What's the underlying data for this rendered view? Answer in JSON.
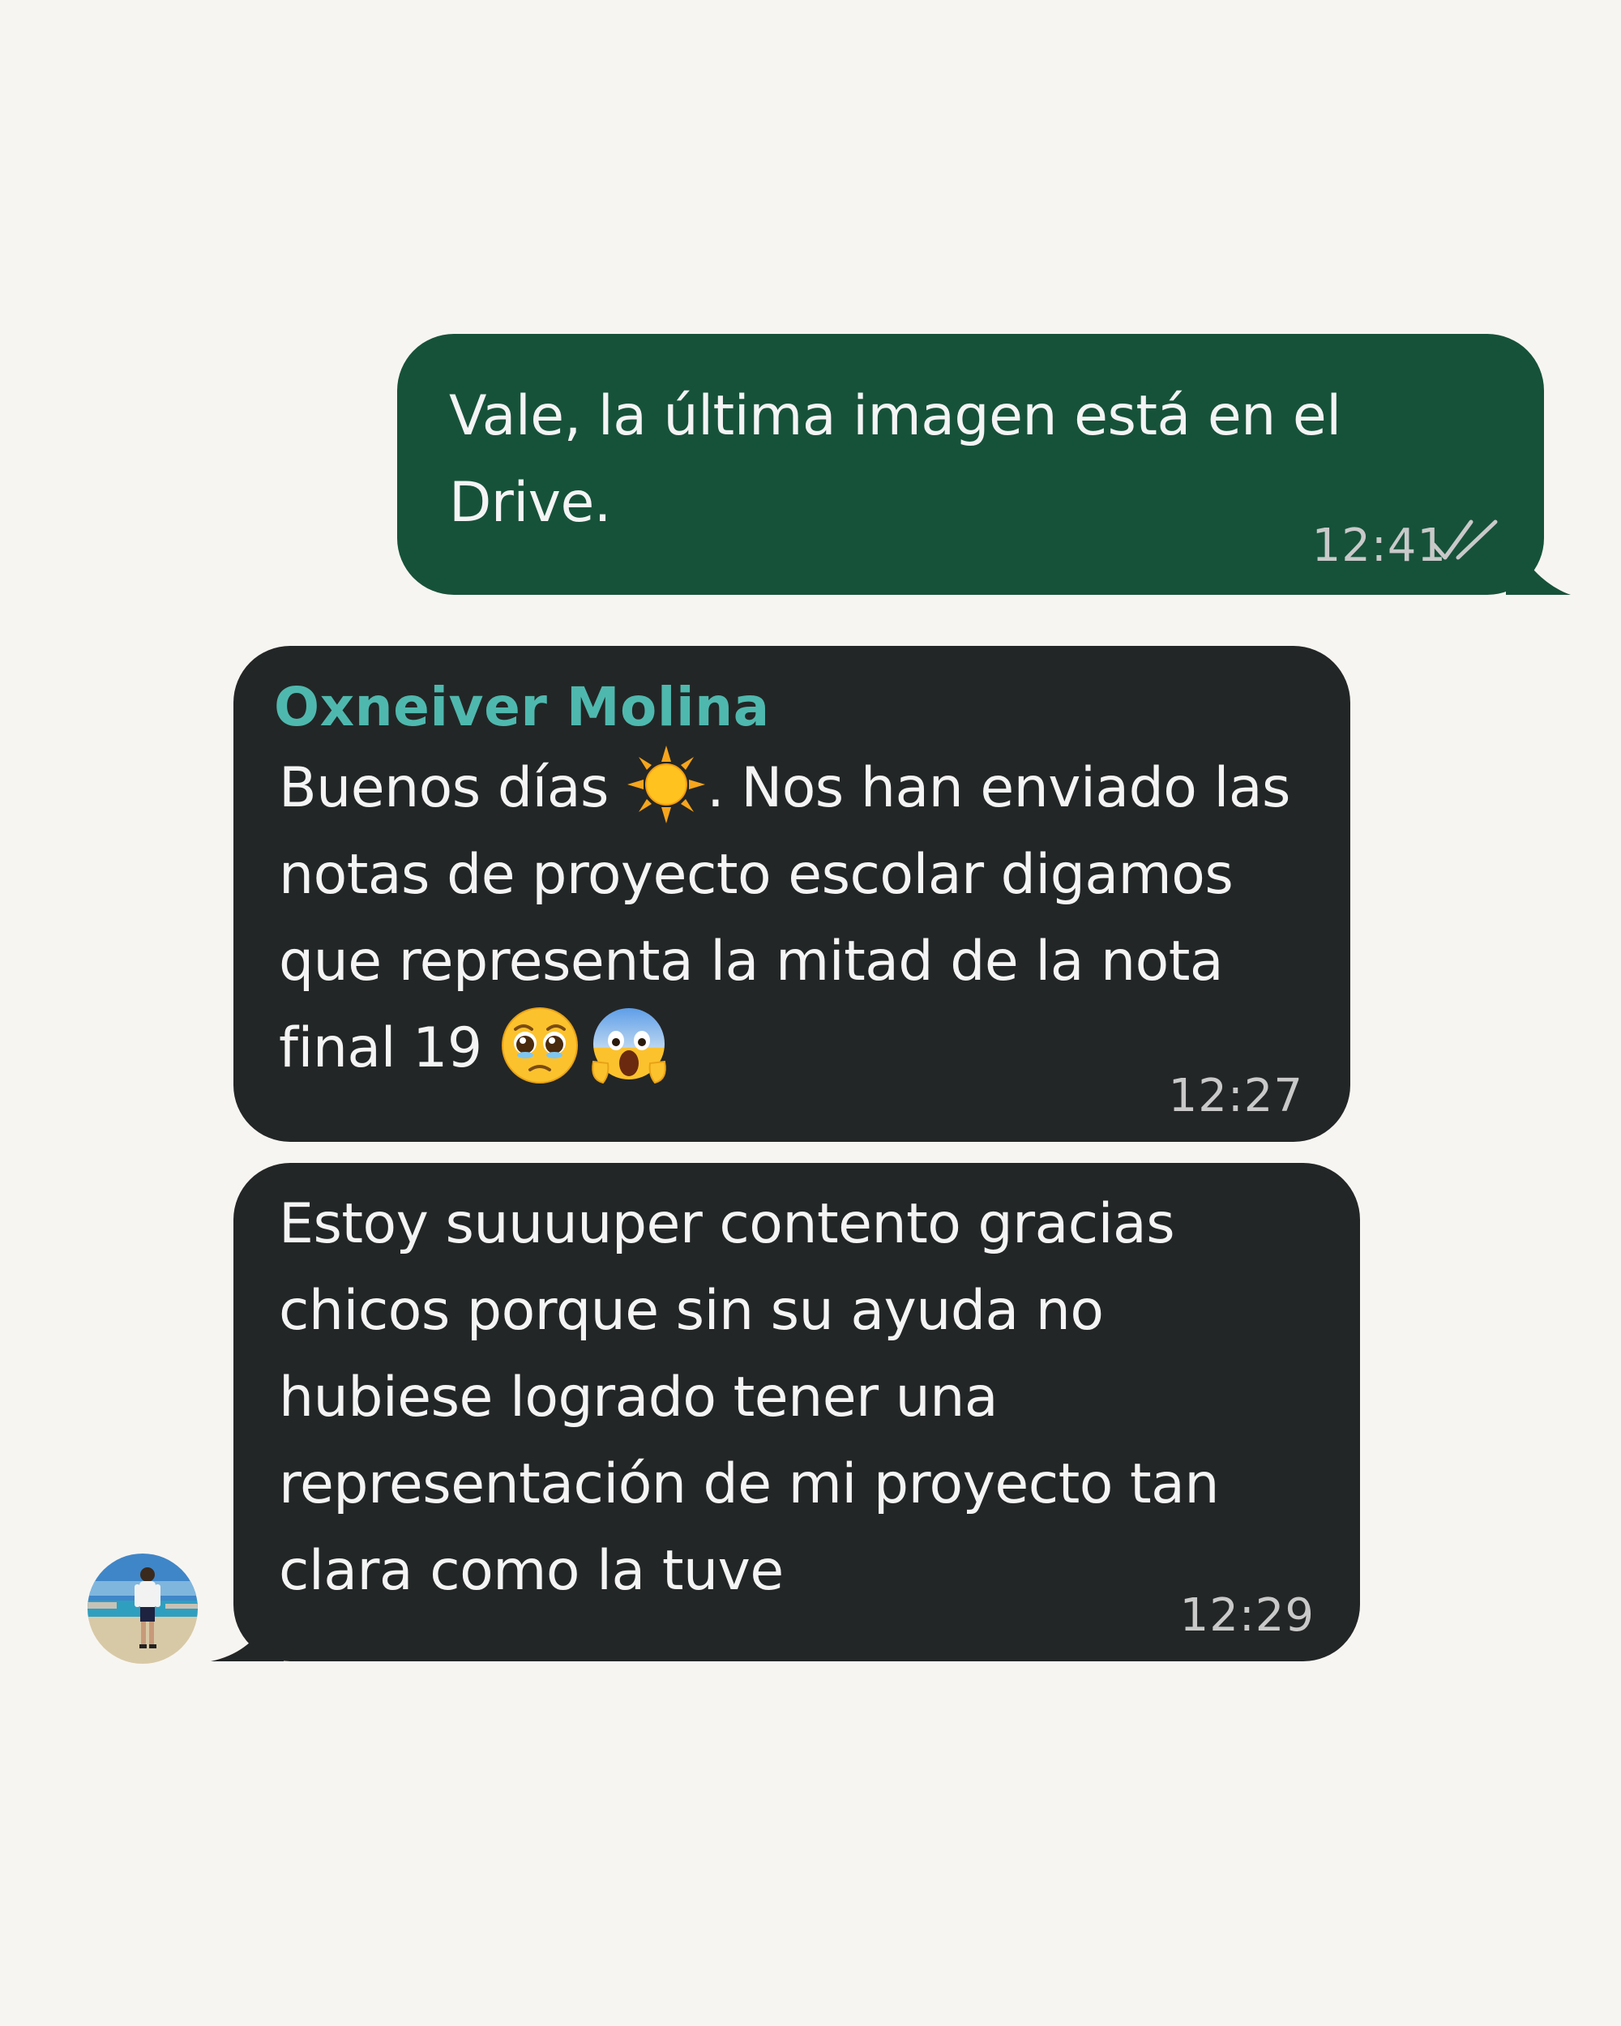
{
  "messages": [
    {
      "direction": "outgoing",
      "text": "Vale, la última imagen está en el Drive.",
      "time": "12:41",
      "status_icon": "double-check-icon"
    },
    {
      "direction": "incoming",
      "sender": "Oxneiver Molina",
      "text_before_emoji": "Buenos días ",
      "emoji_1": "sun-emoji",
      "text_after_emoji": ". Nos han enviado las notas de proyecto escolar digamos que representa la mitad de la nota final 19 ",
      "emoji_2": "pleading-face-emoji",
      "emoji_3": "screaming-face-emoji",
      "time": "12:27"
    },
    {
      "direction": "incoming",
      "text": "Estoy suuuuper contento gracias chicos porque sin su ayuda no hubiese logrado tener una representación de mi proyecto tan clara como la tuve",
      "time": "12:29"
    }
  ],
  "colors": {
    "background": "#f7f5f1",
    "outgoing_bubble": "#16523a",
    "incoming_bubble": "#232626",
    "sender_name": "#4fb8ae",
    "timestamp": "#c9c9c9"
  },
  "avatar": "beach-photo-avatar"
}
